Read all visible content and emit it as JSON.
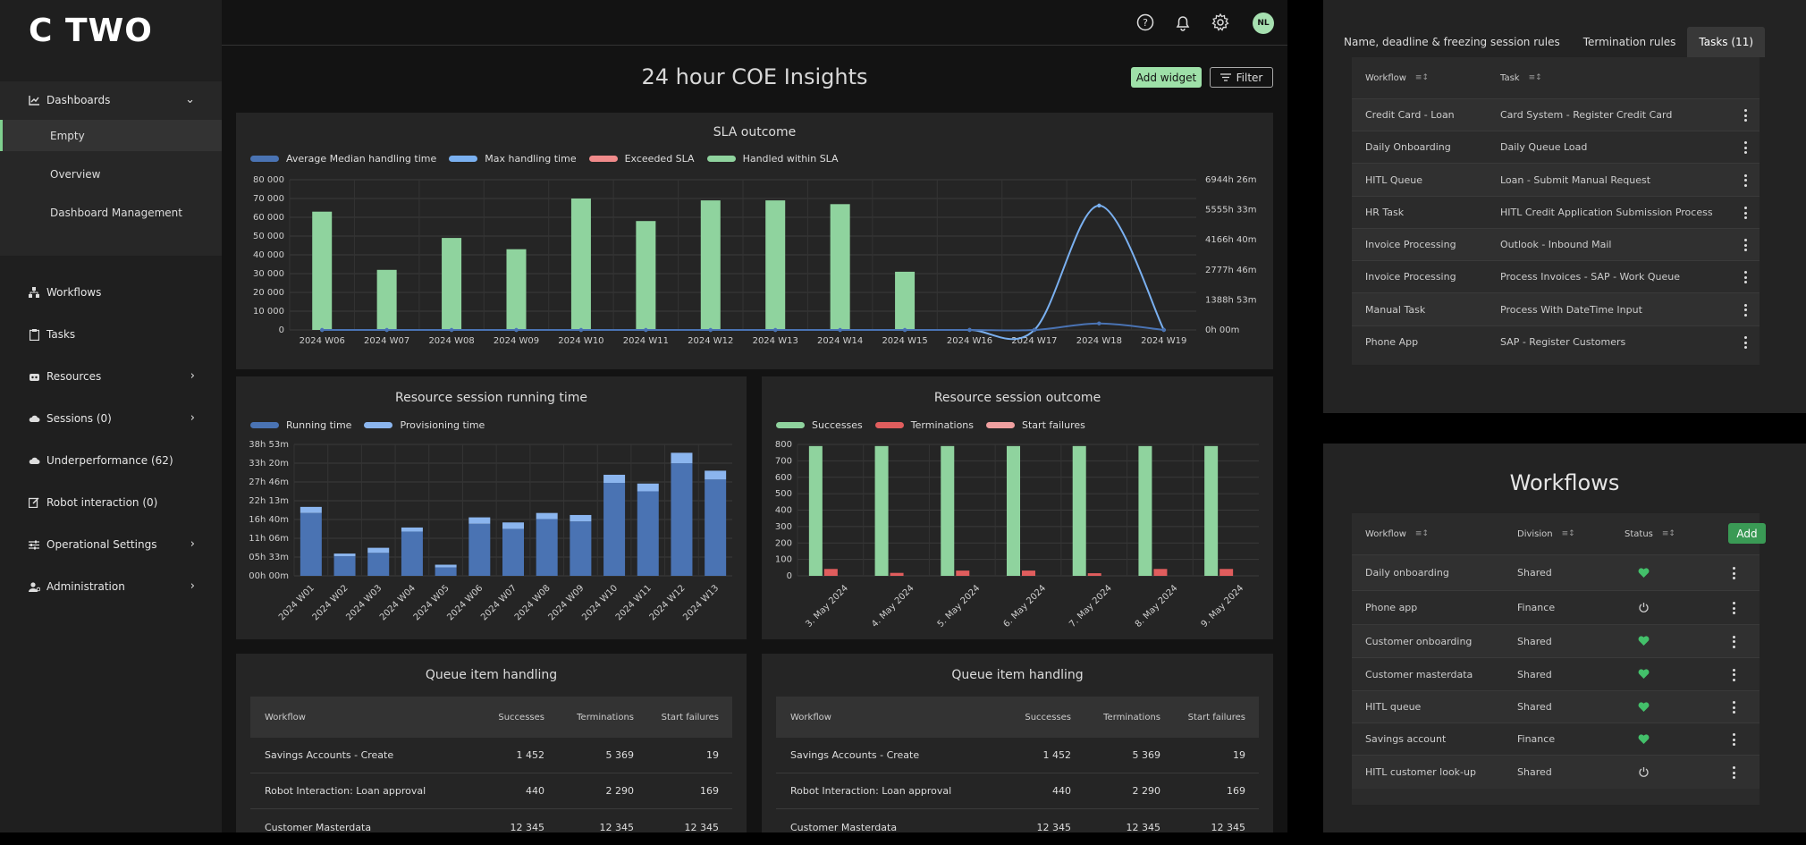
{
  "app": {
    "logo": "C TWO"
  },
  "sidebar": {
    "dashboards": {
      "label": "Dashboards",
      "items": [
        "Empty",
        "Overview",
        "Dashboard Management"
      ]
    },
    "items": [
      {
        "label": "Workflows",
        "icon": "workflow-icon"
      },
      {
        "label": "Tasks",
        "icon": "clipboard-icon"
      },
      {
        "label": "Resources",
        "icon": "robot-icon"
      },
      {
        "label": "Sessions (0)",
        "icon": "cloud-icon"
      },
      {
        "label": "Underperformance (62)",
        "icon": "cloud-icon"
      },
      {
        "label": "Robot interaction (0)",
        "icon": "edit-icon"
      },
      {
        "label": "Operational Settings",
        "icon": "sliders-icon"
      },
      {
        "label": "Administration",
        "icon": "user-gear-icon"
      }
    ]
  },
  "topbar": {
    "avatar": "NL",
    "icons": [
      "help-icon",
      "bell-icon",
      "gear-icon"
    ]
  },
  "page": {
    "title": "24 hour COE Insights",
    "add_widget": "Add widget",
    "filter": "Filter"
  },
  "sla_chart": {
    "title": "SLA outcome",
    "legend": [
      "Average Median handling time",
      "Max handling time",
      "Exceeded SLA",
      "Handled within SLA"
    ],
    "y_ticks": [
      "80 000",
      "70 000",
      "60 000",
      "50 000",
      "40 000",
      "30 000",
      "20 000",
      "10 000",
      "0"
    ],
    "y2_ticks": [
      "6944h 26m",
      "5555h 33m",
      "4166h 40m",
      "2777h 46m",
      "1388h 53m",
      "0h 00m"
    ]
  },
  "running_chart": {
    "title": "Resource session running time",
    "legend": [
      "Running time",
      "Provisioning time"
    ],
    "y_ticks": [
      "38h 53m",
      "33h 20m",
      "27h 46m",
      "22h 13m",
      "16h 40m",
      "11h 06m",
      "05h 33m",
      "00h 00m"
    ]
  },
  "outcome_chart": {
    "title": "Resource session outcome",
    "legend": [
      "Successes",
      "Terminations",
      "Start failures"
    ],
    "y_ticks": [
      "800",
      "700",
      "600",
      "500",
      "400",
      "300",
      "200",
      "100",
      "0"
    ]
  },
  "chart_data": [
    {
      "type": "bar",
      "title": "SLA outcome",
      "categories": [
        "2024 W06",
        "2024 W07",
        "2024 W08",
        "2024 W09",
        "2024 W10",
        "2024 W11",
        "2024 W12",
        "2024 W13",
        "2024 W14",
        "2024 W15",
        "2024 W16",
        "2024 W17",
        "2024 W18",
        "2024 W19"
      ],
      "ylim": [
        0,
        80000
      ],
      "series": [
        {
          "name": "Handled within SLA",
          "color": "#8fd39e",
          "values": [
            63000,
            32000,
            49000,
            43000,
            70000,
            58000,
            69000,
            69000,
            67000,
            31000,
            0,
            0,
            0,
            0
          ]
        },
        {
          "name": "Exceeded SLA",
          "color": "#f08a8a",
          "values": [
            0,
            0,
            0,
            0,
            0,
            0,
            0,
            0,
            0,
            0,
            0,
            0,
            0,
            0
          ]
        },
        {
          "name": "Max handling time",
          "color": "#7ab0f0",
          "values": [
            0,
            0,
            0,
            0,
            0,
            0,
            0,
            0,
            0,
            0,
            0,
            0,
            5750,
            0
          ]
        },
        {
          "name": "Average Median handling time",
          "color": "#4a73b3",
          "values": [
            0,
            0,
            0,
            0,
            0,
            0,
            0,
            0,
            0,
            0,
            0,
            0,
            300,
            0
          ]
        }
      ],
      "y2_range_hours": [
        0,
        6944
      ]
    },
    {
      "type": "bar",
      "title": "Resource session running time",
      "categories": [
        "2024 W01",
        "2024 W02",
        "2024 W03",
        "2024 W04",
        "2024 W05",
        "2024 W06",
        "2024 W07",
        "2024 W08",
        "2024 W09",
        "2024 W10",
        "2024 W11",
        "2024 W12",
        "2024 W13"
      ],
      "ylim_hours": [
        0,
        38.88
      ],
      "series": [
        {
          "name": "Running time",
          "color": "#4a73b3",
          "values": [
            18.6,
            5.8,
            6.8,
            13.1,
            2.5,
            15.4,
            13.9,
            16.8,
            16.1,
            27.5,
            25.0,
            33.3,
            28.5
          ]
        },
        {
          "name": "Provisioning time",
          "color": "#8bb5ee",
          "values": [
            1.8,
            0.8,
            1.5,
            1.2,
            0.8,
            1.9,
            1.9,
            1.8,
            1.9,
            2.4,
            2.3,
            3.1,
            2.6
          ]
        }
      ]
    },
    {
      "type": "bar",
      "title": "Resource session outcome",
      "categories": [
        "3. May 2024",
        "4. May 2024",
        "5. May 2024",
        "6. May 2024",
        "7. May 2024",
        "8. May 2024",
        "9. May 2024"
      ],
      "ylim": [
        0,
        800
      ],
      "series": [
        {
          "name": "Successes",
          "color": "#8fd39e",
          "values": [
            790,
            790,
            790,
            790,
            790,
            790,
            790
          ]
        },
        {
          "name": "Terminations",
          "color": "#e05d5d",
          "values": [
            42,
            18,
            32,
            32,
            16,
            42,
            42
          ]
        },
        {
          "name": "Start failures",
          "color": "#f0a0a0",
          "values": [
            0,
            0,
            0,
            0,
            0,
            0,
            0
          ]
        }
      ]
    }
  ],
  "queue_tables": [
    {
      "title": "Queue item handling",
      "headers": [
        "Workflow",
        "Successes",
        "Terminations",
        "Start failures"
      ],
      "rows": [
        [
          "Savings Accounts - Create",
          "1 452",
          "5 369",
          "19"
        ],
        [
          "Robot Interaction: Loan approval",
          "440",
          "2 290",
          "169"
        ],
        [
          "Customer Masterdata",
          "12 345",
          "12 345",
          "12 345"
        ]
      ]
    },
    {
      "title": "Queue item handling",
      "headers": [
        "Workflow",
        "Successes",
        "Terminations",
        "Start failures"
      ],
      "rows": [
        [
          "Savings Accounts - Create",
          "1 452",
          "5 369",
          "19"
        ],
        [
          "Robot Interaction: Loan approval",
          "440",
          "2 290",
          "169"
        ],
        [
          "Customer Masterdata",
          "12 345",
          "12 345",
          "12 345"
        ]
      ]
    }
  ],
  "rules_panel": {
    "tabs": [
      "Name, deadline & freezing session rules",
      "Termination rules",
      "Tasks (11)"
    ],
    "active_tab": 2,
    "headers": [
      "Workflow",
      "Task"
    ],
    "rows": [
      [
        "Credit Card - Loan",
        "Card System - Register Credit Card"
      ],
      [
        "Daily Onboarding",
        "Daily Queue Load"
      ],
      [
        "HITL Queue",
        "Loan - Submit Manual Request"
      ],
      [
        "HR Task",
        "HITL Credit Application Submission Process"
      ],
      [
        "Invoice Processing",
        "Outlook - Inbound Mail"
      ],
      [
        "Invoice Processing",
        "Process Invoices - SAP - Work Queue"
      ],
      [
        "Manual Task",
        "Process With DateTime Input"
      ],
      [
        "Phone App",
        "SAP - Register Customers"
      ]
    ]
  },
  "workflows_panel": {
    "title": "Workflows",
    "headers": [
      "Workflow",
      "Division",
      "Status"
    ],
    "add_label": "Add",
    "rows": [
      {
        "name": "Daily onboarding",
        "division": "Shared",
        "status": "heart-icon"
      },
      {
        "name": "Phone app",
        "division": "Finance",
        "status": "power-icon"
      },
      {
        "name": "Customer onboarding",
        "division": "Shared",
        "status": "heart-icon"
      },
      {
        "name": "Customer masterdata",
        "division": "Shared",
        "status": "heart-icon"
      },
      {
        "name": "HITL queue",
        "division": "Shared",
        "status": "heart-icon"
      },
      {
        "name": "Savings account",
        "division": "Finance",
        "status": "heart-icon"
      },
      {
        "name": "HITL customer look-up",
        "division": "Shared",
        "status": "power-icon"
      }
    ]
  }
}
